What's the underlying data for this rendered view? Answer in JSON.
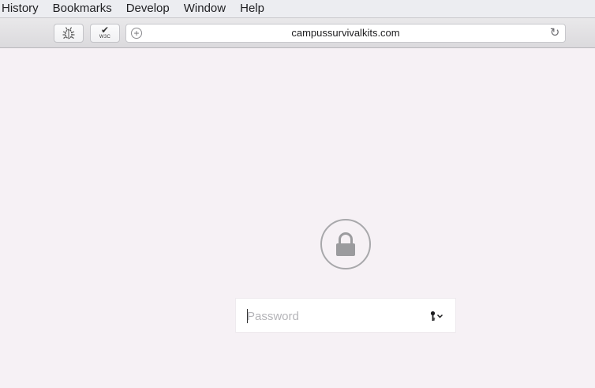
{
  "menubar": {
    "items": [
      {
        "label": "History"
      },
      {
        "label": "Bookmarks"
      },
      {
        "label": "Develop"
      },
      {
        "label": "Window"
      },
      {
        "label": "Help"
      }
    ]
  },
  "toolbar": {
    "web_inspector_icon": "bug-icon",
    "w3c_validator": {
      "label": "W3C",
      "icon": "checkmark-icon"
    },
    "url": "campussurvivalkits.com",
    "new_tab_icon": "plus-circle-icon",
    "reload_icon": "reload-icon"
  },
  "lock_screen": {
    "icon": "lock-icon",
    "password": {
      "placeholder": "Password",
      "value": ""
    },
    "key_menu_icon": "key-icon"
  },
  "colors": {
    "background": "#f6f1f5",
    "menubar": "#ecedf1",
    "lock_gray": "#9b9b9e"
  }
}
